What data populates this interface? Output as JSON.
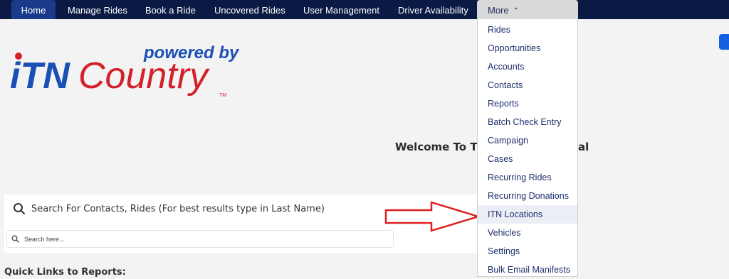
{
  "nav": {
    "items": [
      {
        "label": "Home"
      },
      {
        "label": "Manage Rides"
      },
      {
        "label": "Book a Ride"
      },
      {
        "label": "Uncovered Rides"
      },
      {
        "label": "User Management"
      },
      {
        "label": "Driver Availability"
      }
    ],
    "more_label": "More",
    "more_icon": "chevron-up-icon"
  },
  "logo": {
    "powered_by": "powered by",
    "brand_itn": "iTN",
    "brand_country": "Country",
    "tm": "TM",
    "colors": {
      "blue": "#1a4fb5",
      "red": "#d4202b"
    }
  },
  "welcome": {
    "visible_start": "Welcome To T",
    "visible_end": "al"
  },
  "search": {
    "title": "Search For Contacts, Rides (For best results type in Last Name)",
    "placeholder": "Search here..."
  },
  "quick_links_label": "Quick Links to Reports:",
  "dropdown": {
    "items": [
      {
        "label": "Rides"
      },
      {
        "label": "Opportunities"
      },
      {
        "label": "Accounts"
      },
      {
        "label": "Contacts"
      },
      {
        "label": "Reports"
      },
      {
        "label": "Batch Check Entry"
      },
      {
        "label": "Campaign"
      },
      {
        "label": "Cases"
      },
      {
        "label": "Recurring Rides"
      },
      {
        "label": "Recurring Donations"
      },
      {
        "label": "ITN Locations"
      },
      {
        "label": "Vehicles"
      },
      {
        "label": "Settings"
      },
      {
        "label": "Bulk Email Manifests"
      }
    ],
    "highlighted": "ITN Locations"
  },
  "colors": {
    "nav_bg": "#0b1a45",
    "nav_active": "#1a3a8c",
    "accent": "#1560e0",
    "annotation_arrow": "#e02020"
  }
}
